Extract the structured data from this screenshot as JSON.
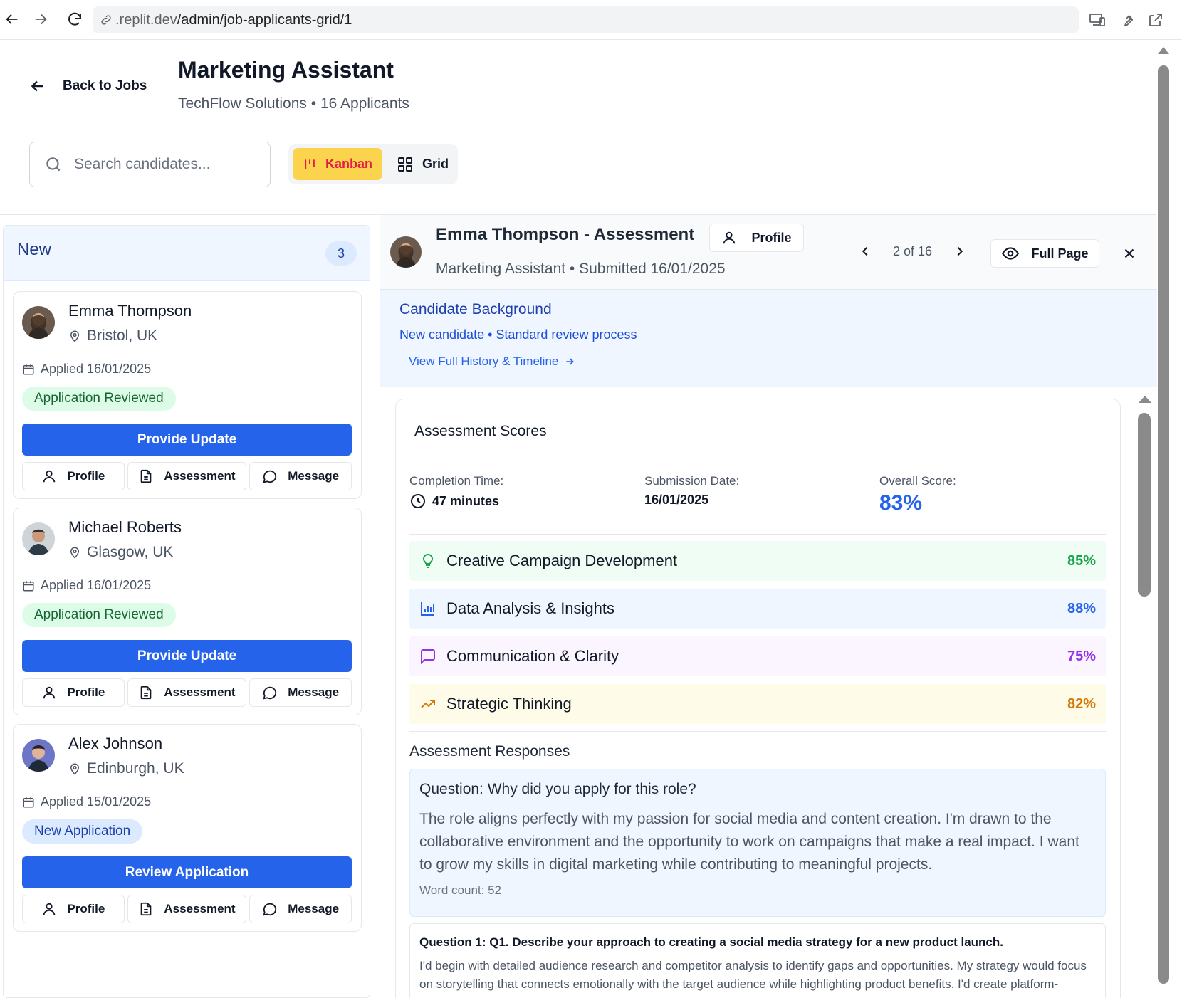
{
  "browser": {
    "url_prefix": ".replit.dev",
    "url_path": "/admin/job-applicants-grid/1"
  },
  "header": {
    "back_label": "Back to Jobs",
    "title": "Marketing Assistant",
    "subtitle": "TechFlow Solutions • 16 Applicants",
    "search_placeholder": "Search candidates...",
    "view_kanban": "Kanban",
    "view_grid": "Grid"
  },
  "column": {
    "name": "New",
    "count": "3",
    "cards": [
      {
        "name": "Emma Thompson",
        "location": "Bristol, UK",
        "applied": "Applied 16/01/2025",
        "status": "Application Reviewed",
        "primary": "Provide Update",
        "profile": "Profile",
        "assessment": "Assessment",
        "message": "Message"
      },
      {
        "name": "Michael Roberts",
        "location": "Glasgow, UK",
        "applied": "Applied 16/01/2025",
        "status": "Application Reviewed",
        "primary": "Provide Update",
        "profile": "Profile",
        "assessment": "Assessment",
        "message": "Message"
      },
      {
        "name": "Alex Johnson",
        "location": "Edinburgh, UK",
        "applied": "Applied 15/01/2025",
        "status": "New Application",
        "primary": "Review Application",
        "profile": "Profile",
        "assessment": "Assessment",
        "message": "Message"
      }
    ]
  },
  "panel": {
    "title": "Emma Thompson - Assessment",
    "profile_label": "Profile",
    "subtitle": "Marketing Assistant • Submitted 16/01/2025",
    "pager": "2 of 16",
    "full_page": "Full Page",
    "background": {
      "title": "Candidate Background",
      "summary": "New candidate • Standard review process",
      "link": "View Full History & Timeline"
    },
    "scores": {
      "title": "Assessment Scores",
      "completion_label": "Completion Time:",
      "completion_value": "47 minutes",
      "submission_label": "Submission Date:",
      "submission_value": "16/01/2025",
      "overall_label": "Overall Score:",
      "overall_value": "83%",
      "categories": [
        {
          "name": "Creative Campaign Development",
          "value": "85%",
          "color": "#16a34a",
          "icon": "lightbulb-icon"
        },
        {
          "name": "Data Analysis & Insights",
          "value": "88%",
          "color": "#2563eb",
          "icon": "bar-chart-icon"
        },
        {
          "name": "Communication & Clarity",
          "value": "75%",
          "color": "#9333ea",
          "icon": "message-square-icon"
        },
        {
          "name": "Strategic Thinking",
          "value": "82%",
          "color": "#d97706",
          "icon": "trending-up-icon"
        }
      ]
    },
    "responses": {
      "title": "Assessment Responses",
      "main_question": "Question: Why did you apply for this role?",
      "main_answer": "The role aligns perfectly with my passion for social media and content creation. I'm drawn to the collaborative environment and the opportunity to work on campaigns that make a real impact. I want to grow my skills in digital marketing while contributing to meaningful projects.",
      "word_count": "Word count: 52",
      "q1_question": "Question 1: Q1. Describe your approach to creating a social media strategy for a new product launch.",
      "q1_answer": "I'd begin with detailed audience research and competitor analysis to identify gaps and opportunities. My strategy would focus on storytelling that connects emotionally with the target audience while highlighting product benefits. I'd create platform-specific content calendars with engaging visuals and interactive elements."
    }
  }
}
